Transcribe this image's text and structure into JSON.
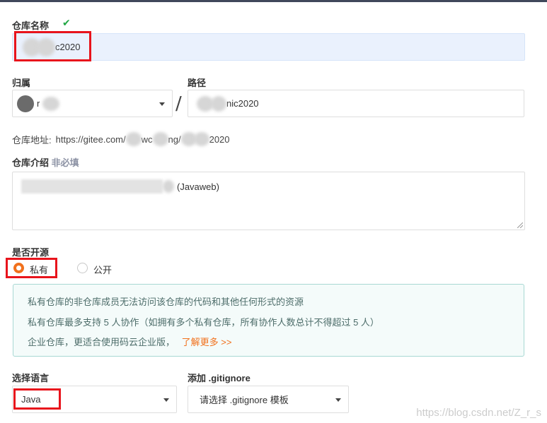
{
  "form": {
    "repo_name": {
      "label": "仓库名称",
      "value": "c2020"
    },
    "owner": {
      "label": "归属",
      "value": "r"
    },
    "path": {
      "label": "路径",
      "value": "nic2020"
    },
    "separator": "/",
    "address": {
      "label": "仓库地址:",
      "prefix": "https://gitee.com/",
      "middle": "wc",
      "middle2": "ng/",
      "suffix": "2020"
    },
    "intro": {
      "label": "仓库介绍",
      "optional": "非必填",
      "value": "(Javaweb)"
    },
    "open_source": {
      "label": "是否开源",
      "options": [
        {
          "label": "私有",
          "selected": true
        },
        {
          "label": "公开",
          "selected": false
        }
      ]
    },
    "notice": {
      "line1": "私有仓库的非仓库成员无法访问该仓库的代码和其他任何形式的资源",
      "line2": "私有仓库最多支持 5 人协作（如拥有多个私有仓库，所有协作人数总计不得超过 5 人）",
      "line3": "企业仓库，更适合使用码云企业版，",
      "link": "了解更多 >>"
    },
    "language": {
      "label": "选择语言",
      "value": "Java"
    },
    "gitignore": {
      "label": "添加 .gitignore",
      "value": "请选择 .gitignore 模板"
    }
  },
  "watermark": "https://blog.csdn.net/Z_r_s",
  "colors": {
    "accent": "#f1711d",
    "success": "#21a744",
    "highlight": "#e8141c"
  },
  "icons": {
    "check": "check-icon",
    "caret": "chevron-down-icon"
  }
}
